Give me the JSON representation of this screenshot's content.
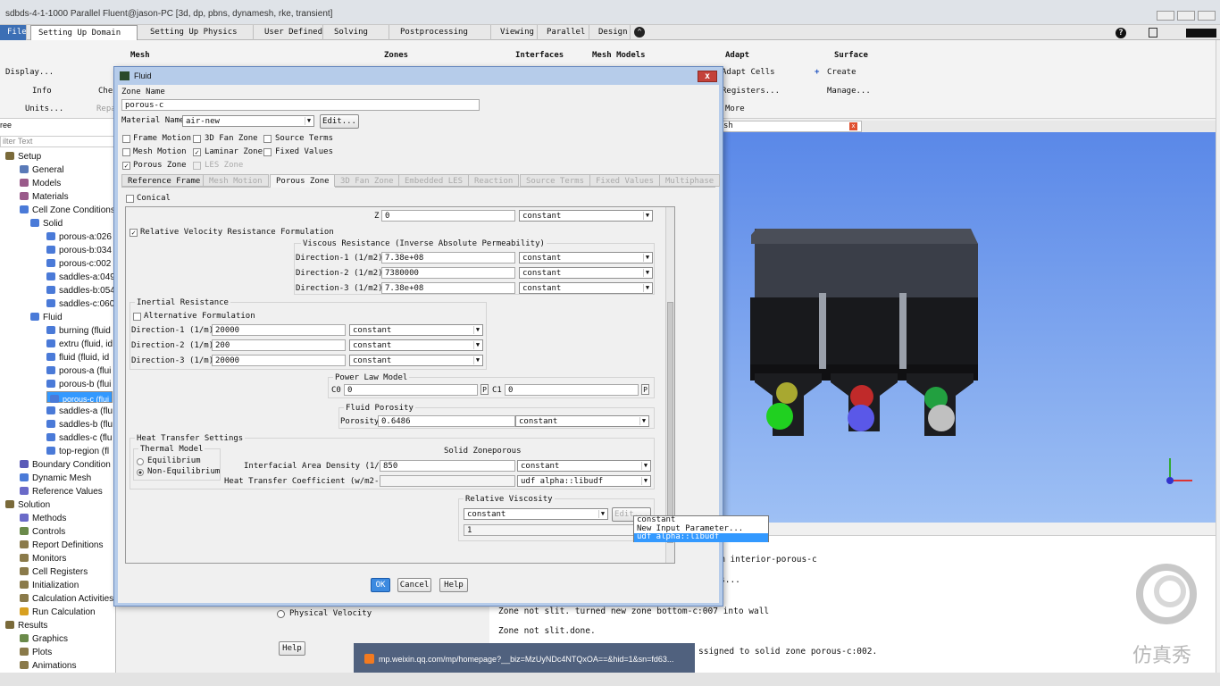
{
  "window": {
    "title": "sdbds-4-1-1000 Parallel Fluent@jason-PC  [3d, dp, pbns, dynamesh, rke, transient]"
  },
  "menu": {
    "file": "File",
    "tabs": [
      "Setting Up Domain",
      "Setting Up Physics",
      "User Defined",
      "Solving",
      "Postprocessing",
      "Viewing",
      "Parallel",
      "Design"
    ]
  },
  "ribbon": {
    "mesh": "Mesh",
    "zones": "Zones",
    "interfaces": "Interfaces",
    "mesh_models": "Mesh Models",
    "adapt": "Adapt",
    "surface": "Surface",
    "display": "Display...",
    "info": "Info",
    "units": "Units...",
    "che": "Che",
    "repa": "Repa",
    "adapt_cells": "Adapt Cells",
    "registers": "Registers...",
    "more": "More",
    "create": "Create",
    "manage": "Manage..."
  },
  "tree": {
    "header": "ree",
    "filter": "ilter Text",
    "items": [
      {
        "label": "Setup",
        "c": "#7a6a3a"
      },
      {
        "label": "General",
        "c": "#5a7ab8"
      },
      {
        "label": "Models",
        "c": "#9a5a8a"
      },
      {
        "label": "Materials",
        "c": "#9a5a8a"
      },
      {
        "label": "Cell Zone Conditions",
        "c": "#4a7ad8"
      },
      {
        "label": "Solid",
        "c": "#4a7ad8"
      },
      {
        "label": "porous-a:026",
        "c": "#4a7ad8"
      },
      {
        "label": "porous-b:034",
        "c": "#4a7ad8"
      },
      {
        "label": "porous-c:002",
        "c": "#4a7ad8"
      },
      {
        "label": "saddles-a:049",
        "c": "#4a7ad8"
      },
      {
        "label": "saddles-b:054",
        "c": "#4a7ad8"
      },
      {
        "label": "saddles-c:060",
        "c": "#4a7ad8"
      },
      {
        "label": "Fluid",
        "c": "#4a7ad8"
      },
      {
        "label": "burning (fluid",
        "c": "#4a7ad8"
      },
      {
        "label": "extru (fluid, id",
        "c": "#4a7ad8"
      },
      {
        "label": "fluid (fluid, id",
        "c": "#4a7ad8"
      },
      {
        "label": "porous-a (flui",
        "c": "#4a7ad8"
      },
      {
        "label": "porous-b (flui",
        "c": "#4a7ad8"
      },
      {
        "label": "porous-c (flui",
        "c": "#4a7ad8"
      },
      {
        "label": "saddles-a (flu",
        "c": "#4a7ad8"
      },
      {
        "label": "saddles-b (flu",
        "c": "#4a7ad8"
      },
      {
        "label": "saddles-c (flu",
        "c": "#4a7ad8"
      },
      {
        "label": "top-region (fl",
        "c": "#4a7ad8"
      },
      {
        "label": "Boundary Condition",
        "c": "#5a5ab8"
      },
      {
        "label": "Dynamic Mesh",
        "c": "#4a7ad8"
      },
      {
        "label": "Reference Values",
        "c": "#6a6ac8"
      },
      {
        "label": "Solution",
        "c": "#7a6a3a"
      },
      {
        "label": "Methods",
        "c": "#6a6ac8"
      },
      {
        "label": "Controls",
        "c": "#6a8a4a"
      },
      {
        "label": "Report Definitions",
        "c": "#8a7a4a"
      },
      {
        "label": "Monitors",
        "c": "#8a7a4a"
      },
      {
        "label": "Cell Registers",
        "c": "#8a7a4a"
      },
      {
        "label": "Initialization",
        "c": "#8a7a4a"
      },
      {
        "label": "Calculation Activities",
        "c": "#8a7a4a"
      },
      {
        "label": "Run Calculation",
        "c": "#d8a020"
      },
      {
        "label": "Results",
        "c": "#7a6a3a"
      },
      {
        "label": "Graphics",
        "c": "#6a8a4a"
      },
      {
        "label": "Plots",
        "c": "#8a7a4a"
      },
      {
        "label": "Animations",
        "c": "#8a7a4a"
      }
    ]
  },
  "dialog": {
    "title": "Fluid",
    "zone_name_label": "Zone Name",
    "zone_name": "porous-c",
    "material_label": "Material Name",
    "material": "air-new",
    "edit": "Edit...",
    "checks": {
      "frame_motion": "Frame Motion",
      "fan_zone": "3D Fan Zone",
      "source_terms": "Source Terms",
      "mesh_motion": "Mesh Motion",
      "laminar_zone": "Laminar Zone",
      "fixed_values": "Fixed Values",
      "porous_zone": "Porous Zone",
      "les_zone": "LES Zone"
    },
    "tabs": [
      "Reference Frame",
      "Mesh Motion",
      "Porous Zone",
      "3D Fan Zone",
      "Embedded LES",
      "Reaction",
      "Source Terms",
      "Fixed Values",
      "Multiphase"
    ],
    "conical": "Conical",
    "z_label": "Z",
    "z_value": "0",
    "constant": "constant",
    "relvel": "Relative Velocity Resistance Formulation",
    "viscous_title": "Viscous Resistance (Inverse Absolute Permeability)",
    "viscous": [
      {
        "l": "Direction-1 (1/m2)",
        "v": "7.38e+08"
      },
      {
        "l": "Direction-2 (1/m2)",
        "v": "7380000"
      },
      {
        "l": "Direction-3 (1/m2)",
        "v": "7.38e+08"
      }
    ],
    "inertial_title": "Inertial Resistance",
    "alt_form": "Alternative Formulation",
    "inertial": [
      {
        "l": "Direction-1 (1/m)",
        "v": "20000"
      },
      {
        "l": "Direction-2 (1/m)",
        "v": "200"
      },
      {
        "l": "Direction-3 (1/m)",
        "v": "20000"
      }
    ],
    "powerlaw_title": "Power Law Model",
    "c0": "C0",
    "c0v": "0",
    "c1": "C1",
    "c1v": "0",
    "p": "P",
    "porosity_title": "Fluid Porosity",
    "porosity_label": "Porosity",
    "porosity": "0.6486",
    "dropdown": [
      "constant",
      "New Input Parameter...",
      "udf alpha::libudf"
    ],
    "heat_title": "Heat Transfer Settings",
    "thermal_title": "Thermal Model",
    "equilibrium": "Equilibrium",
    "non_equilibrium": "Non-Equilibrium",
    "solid_zone_label": "Solid Zone",
    "solid_zone": "porous",
    "iad_label": "Interfacial Area Density (1/m)",
    "iad": "850",
    "htc_label": "Heat Transfer Coefficient (w/m2-k)",
    "udf": "udf alpha::libudf",
    "relvisc_title": "Relative Viscosity",
    "relvisc": "1",
    "edit_dis": "Edit...",
    "ok": "OK",
    "cancel": "Cancel",
    "help": "Help"
  },
  "viewport": {
    "tab": "sh"
  },
  "console": {
    "lines": [
      "m interior-porous-c",
      "s...",
      "Zone not slit.   turned new zone bottom-c:007 into wall",
      "Zone not slit.done.",
      "ssigned to solid zone porous-c:002."
    ]
  },
  "bottom": {
    "physical_velocity": "Physical Velocity",
    "help": "Help"
  },
  "notification": {
    "url": "mp.weixin.qq.com/mp/homepage?__biz=MzUyNDc4NTQxOA==&hid=1&sn=fd63..."
  },
  "watermark": "仿真秀"
}
